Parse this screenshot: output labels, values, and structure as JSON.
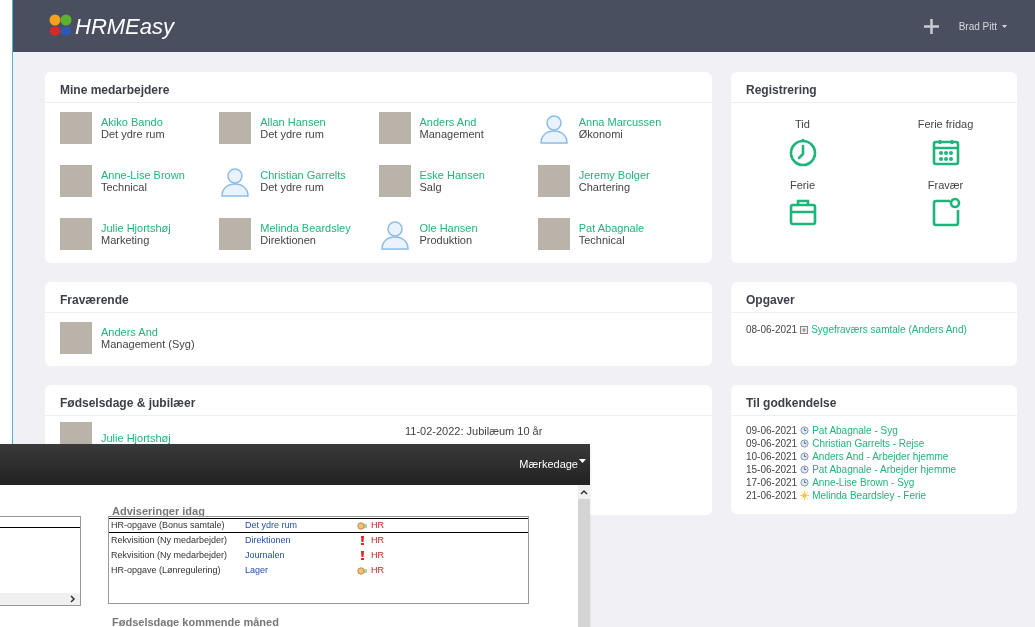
{
  "header": {
    "logo": "HRMEasy",
    "user": "Brad Pitt"
  },
  "employees": {
    "title": "Mine medarbejdere",
    "items": [
      {
        "name": "Akiko Bando",
        "department": "Det ydre rum",
        "kind": "photo"
      },
      {
        "name": "Allan Hansen",
        "department": "Det ydre rum",
        "kind": "photo"
      },
      {
        "name": "Anders And",
        "department": "Management",
        "kind": "photo"
      },
      {
        "name": "Anna Marcussen",
        "department": "Økonomi",
        "kind": "silhouette"
      },
      {
        "name": "Anne-Lise Brown",
        "department": "Technical",
        "kind": "photo"
      },
      {
        "name": "Christian Garrelts",
        "department": "Det ydre rum",
        "kind": "silhouette"
      },
      {
        "name": "Eske Hansen",
        "department": "Salg",
        "kind": "photo"
      },
      {
        "name": "Jeremy Bolger",
        "department": "Chartering",
        "kind": "photo"
      },
      {
        "name": "Julie Hjortshøj",
        "department": "Marketing",
        "kind": "photo"
      },
      {
        "name": "Melinda Beardsley",
        "department": "Direktionen",
        "kind": "photo"
      },
      {
        "name": "Ole Hansen",
        "department": "Produktion",
        "kind": "silhouette"
      },
      {
        "name": "Pat Abagnale",
        "department": "Technical",
        "kind": "photo"
      }
    ]
  },
  "registration": {
    "title": "Registrering",
    "items": [
      {
        "label": "Tid",
        "kind": "clock"
      },
      {
        "label": "Ferie fridag",
        "kind": "calendar"
      },
      {
        "label": "Ferie",
        "kind": "briefcase"
      },
      {
        "label": "Fravær",
        "kind": "note"
      }
    ]
  },
  "absent": {
    "title": "Fraværende",
    "items": [
      {
        "name": "Anders And",
        "detail": "Management (Syg)",
        "kind": "photo"
      }
    ]
  },
  "tasks": {
    "title": "Opgaver",
    "items": [
      {
        "date": "08-06-2021",
        "text": "Sygefraværs samtale (Anders And)"
      }
    ]
  },
  "birthdays": {
    "title": "Fødselsdage & jubilæer",
    "items": [
      {
        "name": "Julie Hjortshøj",
        "kind": "photo",
        "event": "11-02-2022: Jubilæum 10 år"
      }
    ]
  },
  "approval": {
    "title": "Til godkendelse",
    "items": [
      {
        "date": "09-06-2021",
        "text": "Pat Abagnale - Syg",
        "kind": "pending"
      },
      {
        "date": "09-06-2021",
        "text": "Christian Garrelts - Rejse",
        "kind": "pending"
      },
      {
        "date": "10-06-2021",
        "text": "Anders And - Arbejder hjemme",
        "kind": "pending"
      },
      {
        "date": "15-06-2021",
        "text": "Pat Abagnale - Arbejder hjemme",
        "kind": "pending"
      },
      {
        "date": "17-06-2021",
        "text": "Anne-Lise Brown - Syg",
        "kind": "pending"
      },
      {
        "date": "21-06-2021",
        "text": "Melinda Beardsley - Ferie",
        "kind": "vacation"
      }
    ]
  },
  "overlay": {
    "menu": "Mærkedage",
    "notifications_title": "Adviseringer idag",
    "notifications": [
      {
        "task": "HR-opgave (Bonus samtale)",
        "department": "Det ydre rum",
        "kind": "task",
        "owner": "HR",
        "selected": true
      },
      {
        "task": "Rekvisition (Ny medarbejder)",
        "department": "Direktionen",
        "kind": "alert",
        "owner": "HR",
        "selected": false
      },
      {
        "task": "Rekvisition (Ny medarbejder)",
        "department": "Journalen",
        "kind": "alert",
        "owner": "HR",
        "selected": false
      },
      {
        "task": "HR-opgave (Lønregulering)",
        "department": "Lager",
        "kind": "task",
        "owner": "HR",
        "selected": false
      }
    ],
    "next_title": "Fødselsdage kommende måned"
  }
}
